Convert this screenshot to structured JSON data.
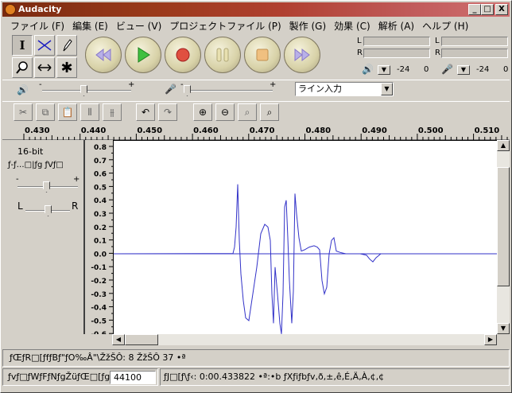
{
  "window": {
    "title": "Audacity",
    "min": "_",
    "max": "□",
    "close": "X"
  },
  "menu": [
    "ファイル (F)",
    "編集 (E)",
    "ビュー (V)",
    "プロジェクトファイル (P)",
    "製作 (G)",
    "効果 (C)",
    "解析 (A)",
    "ヘルプ (H)"
  ],
  "tools": {
    "select": "I",
    "envelope": "⋈",
    "draw": "✎",
    "zoom": "🔍",
    "timeshift": "↔",
    "multi": "✱"
  },
  "meters": {
    "left_label": "L",
    "right_label": "R",
    "play_db": "-24",
    "play_zero": "0",
    "rec_db": "-24",
    "rec_zero": "0"
  },
  "mixer": {
    "input_source": "ライン入力",
    "volume_plus": "+",
    "volume_minus": "-",
    "rec_plus": "+",
    "rec_minus": "-"
  },
  "ruler": {
    "ticks": [
      "0.430",
      "0.440",
      "0.450",
      "0.460",
      "0.470",
      "0.480",
      "0.490",
      "0.500",
      "0.510"
    ]
  },
  "track": {
    "bit_depth": "16-bit",
    "menu_label": "ƒ-ƒ…□|ƒg ƒVƒ□",
    "gain_minus": "-",
    "gain_plus": "+",
    "pan_left": "L",
    "pan_right": "R",
    "y_ticks": [
      "0.8",
      "0.7",
      "0.6",
      "0.5",
      "0.4",
      "0.3",
      "0.2",
      "0.1",
      "0.0",
      "-0.1",
      "-0.2",
      "-0.3",
      "-0.4",
      "-0.5",
      "-0.6"
    ]
  },
  "status": {
    "line1": "ƒŒƒR□[ƒfƒBƒ\"ƒO‰Â\"\\ŽžŠÔ: 8 ŽžŠÔ 37 •ª",
    "rate_label": "ƒvƒ□ƒWƒFƒNƒgŽüƒŒ□[ƒg:",
    "rate_value": "44100",
    "cursor_info": "ƒJ□[ƒ\\ƒ‹: 0:00.433822 •ª:•b   ƒXƒiƒbƒv‚ð‚±‚ê‚É‚Ä‚À‚¢‚¢"
  },
  "colors": {
    "waveform": "#3232c8",
    "title_left": "#7a2a10",
    "title_right": "#d07070"
  }
}
